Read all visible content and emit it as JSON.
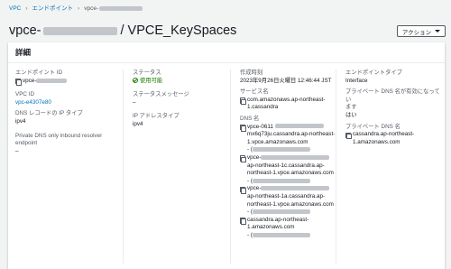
{
  "breadcrumb": {
    "items": [
      "VPC",
      "エンドポイント",
      "vpce-"
    ]
  },
  "header": {
    "title_prefix": "vpce-",
    "title_suffix": "/ VPCE_KeySpaces",
    "action_label": "アクション"
  },
  "panel": {
    "title": "詳細",
    "col1": {
      "endpoint_id_label": "エンドポイント ID",
      "endpoint_id_value": "vpce-",
      "vpc_id_label": "VPC ID",
      "vpc_id_value": "vpc-e4307e80",
      "dns_record_ip_label": "DNS レコードの IP タイプ",
      "dns_record_ip_value": "ipv4",
      "private_dns_inbound_label_1": "Private DNS only inbound resolver",
      "private_dns_inbound_label_2": "endpoint",
      "private_dns_inbound_value": "–"
    },
    "col2": {
      "status_label": "ステータス",
      "status_value": "使用可能",
      "status_message_label": "ステータスメッセージ",
      "status_message_value": "–",
      "ip_address_type_label": "IP アドレスタイプ",
      "ip_address_type_value": "ipv4"
    },
    "col3": {
      "created_label": "作成時刻",
      "created_value": "2023年9月26日火曜日 12:46:44 JST",
      "service_name_label": "サービス名",
      "service_name_1": "com.amazonaws.ap-northeast-",
      "service_name_2": "1.cassandra",
      "dns_name_label": "DNS 名",
      "dns1_l1": "vpce-0611",
      "dns1_l2": "mx6q73ju.cassandra.ap-northeast-",
      "dns1_l3": "1.vpce.amazonaws.com",
      "dns1_l4": "- (",
      "dns2_l1": "vpce-",
      "dns2_l2": "ap-northeast-1c.cassandra.ap-",
      "dns2_l3": "northeast-1.vpce.amazonaws.com",
      "dns2_l4": "- (",
      "dns3_l1": "vpce-",
      "dns3_l2": "ap-northeast-1a.cassandra.ap-",
      "dns3_l3": "northeast-1.vpce.amazonaws.com",
      "dns3_l4": "- (",
      "dns4_l1": "cassandra.ap-northeast-",
      "dns4_l2": "1.amazonaws.com",
      "dns4_l3": "- ("
    },
    "col4": {
      "endpoint_type_label": "エンドポイントタイプ",
      "endpoint_type_value": "Interface",
      "private_dns_enabled_label_1": "プライベート DNS 名が有効になってい",
      "private_dns_enabled_label_2": "ます",
      "private_dns_enabled_value": "はい",
      "private_dns_name_label": "プライベート DNS 名",
      "private_dns_name_1": "cassandra.ap-northeast-",
      "private_dns_name_2": "1.amazonaws.com"
    }
  }
}
